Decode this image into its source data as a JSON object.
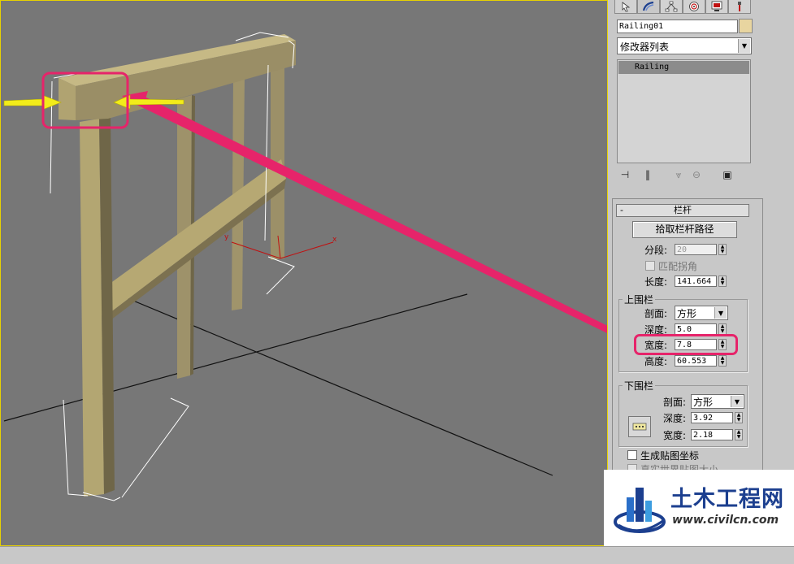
{
  "viewport": {
    "axis_label_x": "x",
    "axis_label_y": "y"
  },
  "panel": {
    "tabs": [
      "create-icon",
      "modify-icon",
      "hierarchy-icon",
      "motion-icon",
      "display-icon",
      "utilities-icon"
    ],
    "object_name": "Railing01",
    "object_color": "#e8d5a0",
    "modifier_list_label": "修改器列表",
    "stack_item": "Railing",
    "rollout_title": "栏杆",
    "rollout_collapse": "-",
    "pick_path_button": "拾取栏杆路径",
    "segments_label": "分段:",
    "segments_value": "20",
    "match_corners_label": "匹配拐角",
    "length_label": "长度:",
    "length_value": "141.664",
    "top_rail": {
      "title": "上围栏",
      "profile_label": "剖面:",
      "profile_value": "方形",
      "depth_label": "深度:",
      "depth_value": "5.0",
      "width_label": "宽度:",
      "width_value": "7.8",
      "height_label": "高度:",
      "height_value": "60.553"
    },
    "lower_rail": {
      "title": "下围栏",
      "profile_label": "剖面:",
      "profile_value": "方形",
      "depth_label": "深度:",
      "depth_value": "3.92",
      "width_label": "宽度:",
      "width_value": "2.18"
    },
    "gen_mapping_label": "生成贴图坐标",
    "real_world_label": "真实世界贴图大小"
  },
  "watermark": {
    "title": "土木工程网",
    "url": "www.civilcn.com"
  },
  "colors": {
    "annotation_pink": "#e6246a",
    "annotation_yellow": "#f2ec1a",
    "wood": "#b3a672",
    "viewport_bg": "#777777"
  }
}
